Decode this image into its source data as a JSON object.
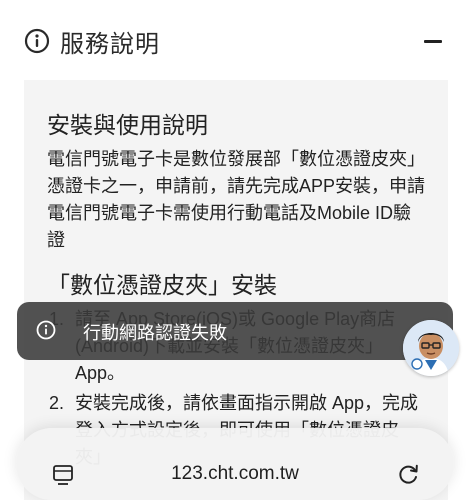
{
  "section": {
    "title": "服務說明",
    "icon": "info-icon",
    "collapse_icon": "minus-icon"
  },
  "content": {
    "subtitle": "安裝與使用說明",
    "intro": "電信門號電子卡是數位發展部「數位憑證皮夾」憑證卡之一，申請前，請先完成APP安裝，申請電信門號電子卡需使用行動電話及Mobile ID驗證",
    "install_title": "「數位憑證皮夾」安裝",
    "steps": [
      {
        "num": "1.",
        "text": "請至 App Store(iOS)或 Google Play商店(Android)下載並安裝「數位憑證皮夾」App。"
      },
      {
        "num": "2.",
        "text": "安裝完成後，請依畫面指示開啟 App，完成登入方式設定後，即可使用「數位憑證皮夾」"
      }
    ]
  },
  "toast": {
    "icon": "info-icon",
    "message": "行動網路認證失敗"
  },
  "avatar": {
    "icon": "assistant-avatar"
  },
  "browser_bar": {
    "url": "123.cht.com.tw",
    "left_icon": "tabs-icon",
    "right_icon": "reload-icon"
  },
  "colors": {
    "toast_background": "#3a3a3a",
    "panel_background": "#f4f4f4",
    "text": "#222222"
  }
}
